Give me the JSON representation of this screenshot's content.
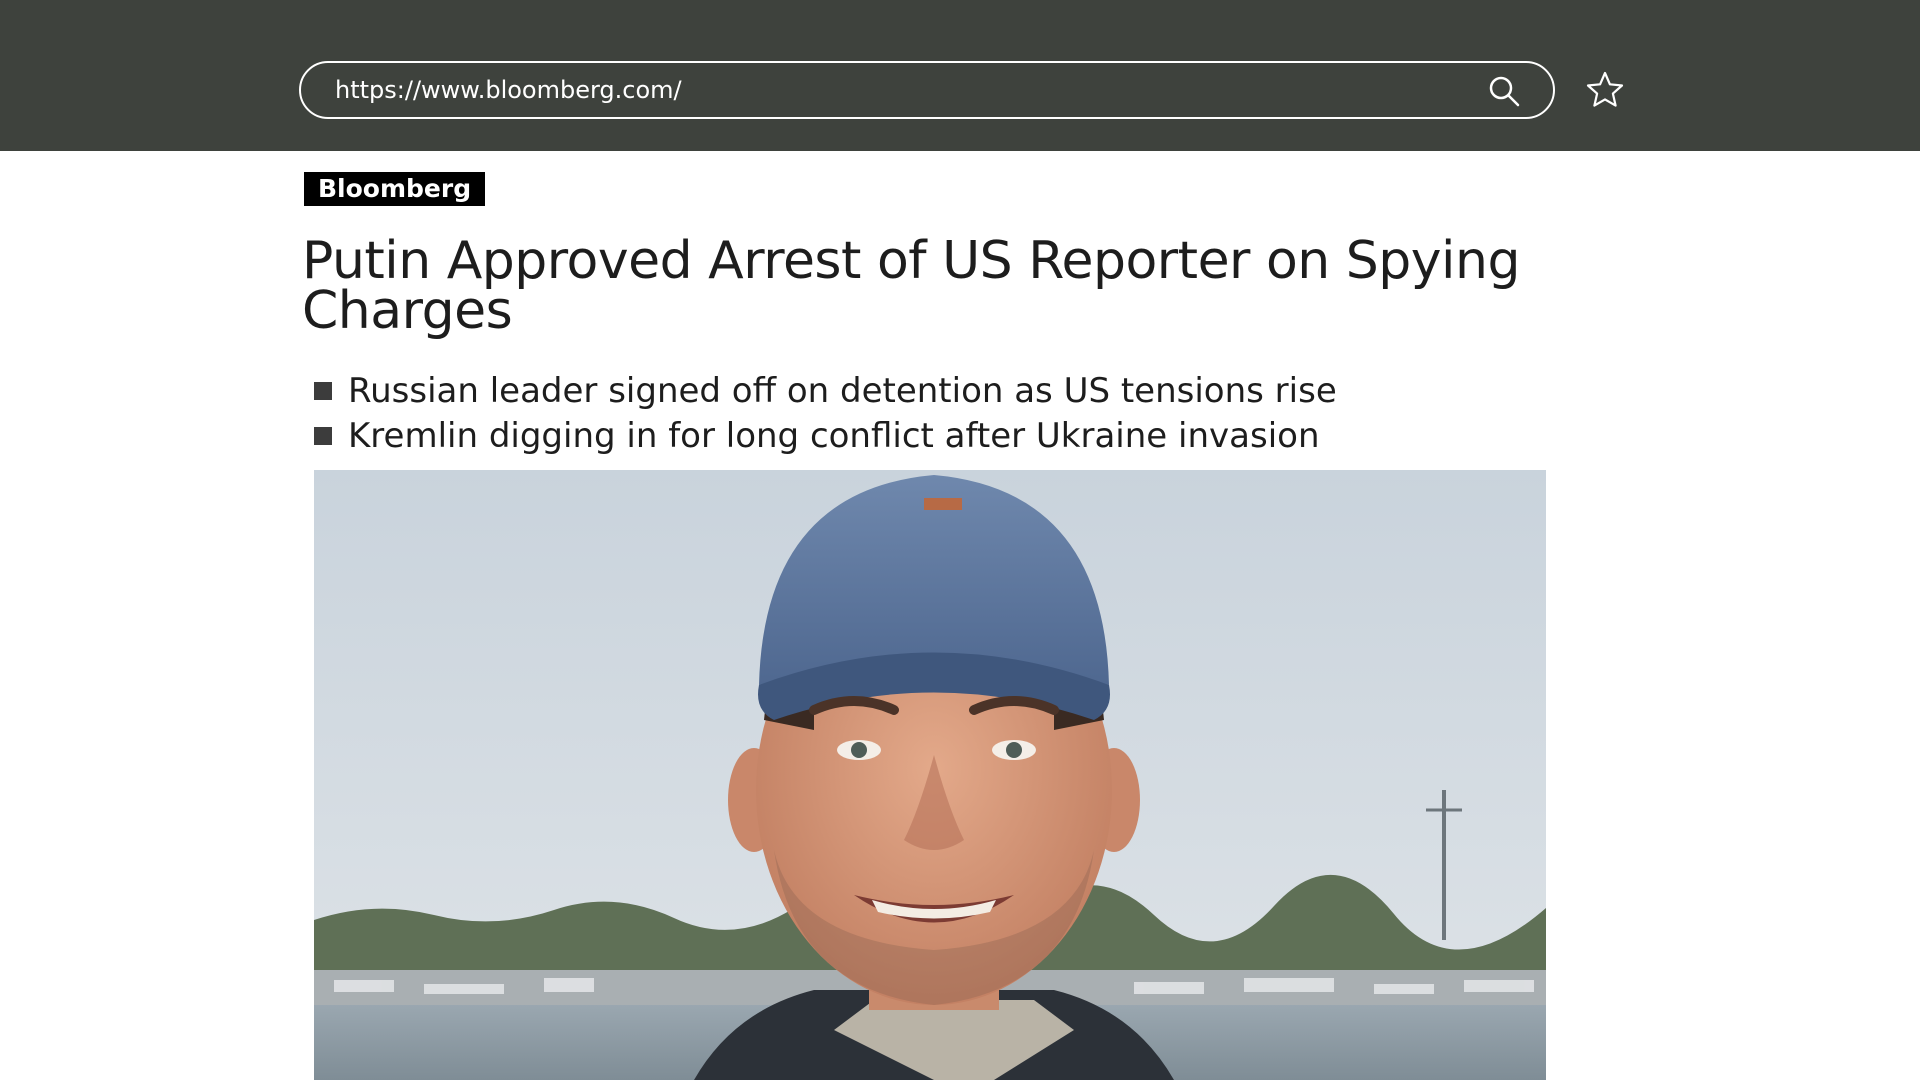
{
  "browser": {
    "url": "https://www.bloomberg.com/",
    "search_icon": "search-icon",
    "star_icon": "star-icon"
  },
  "article": {
    "brand": "Bloomberg",
    "headline": "Putin Approved Arrest of US Reporter on Spying Charges",
    "bullets": [
      "Russian leader signed off on detention as US tensions rise",
      "Kremlin digging in for long conflict after Ukraine invasion"
    ],
    "photo": "man-in-blue-cap-portrait"
  },
  "colors": {
    "topbar": "#3e423d",
    "text": "#1d1d1d",
    "brand_bg": "#000000"
  }
}
